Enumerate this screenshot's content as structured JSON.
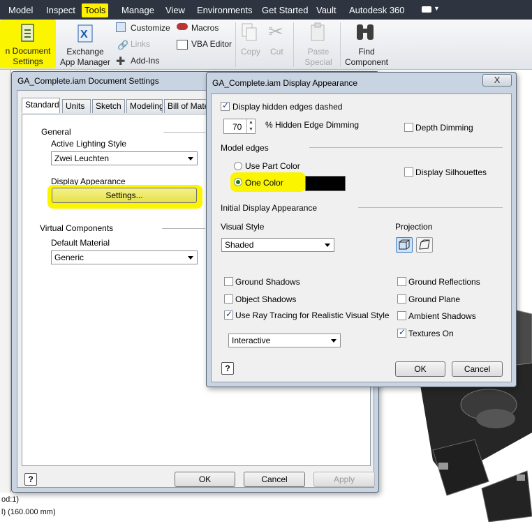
{
  "menubar": {
    "items": [
      "Model",
      "Inspect",
      "Tools",
      "Manage",
      "View",
      "Environments",
      "Get Started",
      "Vault",
      "Autodesk 360"
    ]
  },
  "ribbon": {
    "document_settings": "n Document\nSettings",
    "exchange_app_manager": "Exchange\nApp Manager",
    "customize": "Customize",
    "links": "Links",
    "add_ins": "Add-Ins",
    "macros": "Macros",
    "vba_editor": "VBA Editor",
    "copy": "Copy",
    "cut": "Cut",
    "paste_special": "Paste\nSpecial",
    "find_component": "Find\nComponent"
  },
  "doc_settings": {
    "title": "GA_Complete.iam Document Settings",
    "tabs": [
      "Standard",
      "Units",
      "Sketch",
      "Modeling",
      "Bill of Materia"
    ],
    "general": "General",
    "active_lighting_style_label": "Active Lighting Style",
    "active_lighting_style_value": "Zwei Leuchten",
    "display_appearance_label": "Display Appearance",
    "settings_button": "Settings...",
    "virtual_components": "Virtual Components",
    "default_material_label": "Default Material",
    "default_material_value": "Generic",
    "ok": "OK",
    "cancel": "Cancel",
    "apply": "Apply"
  },
  "display_appearance": {
    "title": "GA_Complete.iam Display Appearance",
    "close": "X",
    "display_hidden_edges_dashed": "Display hidden edges dashed",
    "hidden_edge_dimming_value": "70",
    "hidden_edge_dimming_label": "% Hidden Edge Dimming",
    "depth_dimming": "Depth Dimming",
    "model_edges": "Model edges",
    "use_part_color": "Use Part Color",
    "one_color": "One Color",
    "one_color_swatch": "#000000",
    "display_silhouettes": "Display Silhouettes",
    "initial_display_appearance": "Initial Display Appearance",
    "visual_style_label": "Visual Style",
    "visual_style_value": "Shaded",
    "projection_label": "Projection",
    "ground_shadows": "Ground Shadows",
    "object_shadows": "Object Shadows",
    "use_ray_tracing": "Use Ray Tracing for Realistic Visual Style",
    "ray_tracing_mode": "Interactive",
    "ground_reflections": "Ground Reflections",
    "ground_plane": "Ground Plane",
    "ambient_shadows": "Ambient Shadows",
    "textures_on": "Textures On",
    "ok": "OK",
    "cancel": "Cancel"
  },
  "browser": {
    "line1": "od:1)",
    "line2": "l) (160.000 mm)"
  },
  "colors": {
    "highlight": "#fbf500",
    "menubar_bg": "#2e3540"
  }
}
